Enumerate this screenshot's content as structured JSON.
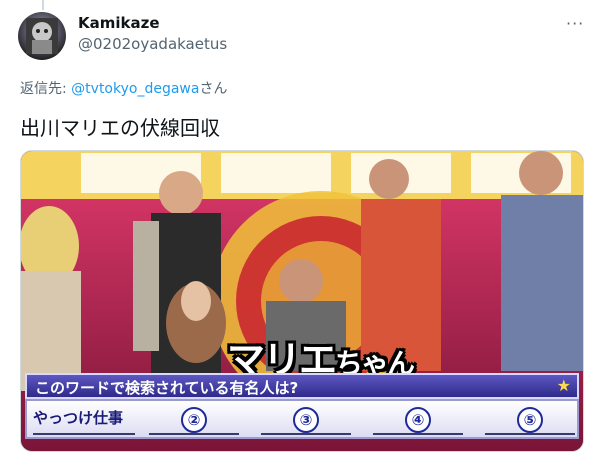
{
  "tweet": {
    "display_name": "Kamikaze",
    "handle": "@0202oyadakaetus",
    "more_icon": "···",
    "replying_prefix": "返信先: ",
    "replying_to": "@tvtokyo_degawa",
    "replying_suffix": "さん",
    "text": "出川マリエの伏線回収"
  },
  "media": {
    "caption_main": "マリエ",
    "caption_small": "ちゃん",
    "question": "このワードで検索されている有名人は?",
    "star_icon": "★",
    "answers": [
      "やっつけ仕事",
      "②",
      "③",
      "④",
      "⑤"
    ]
  }
}
